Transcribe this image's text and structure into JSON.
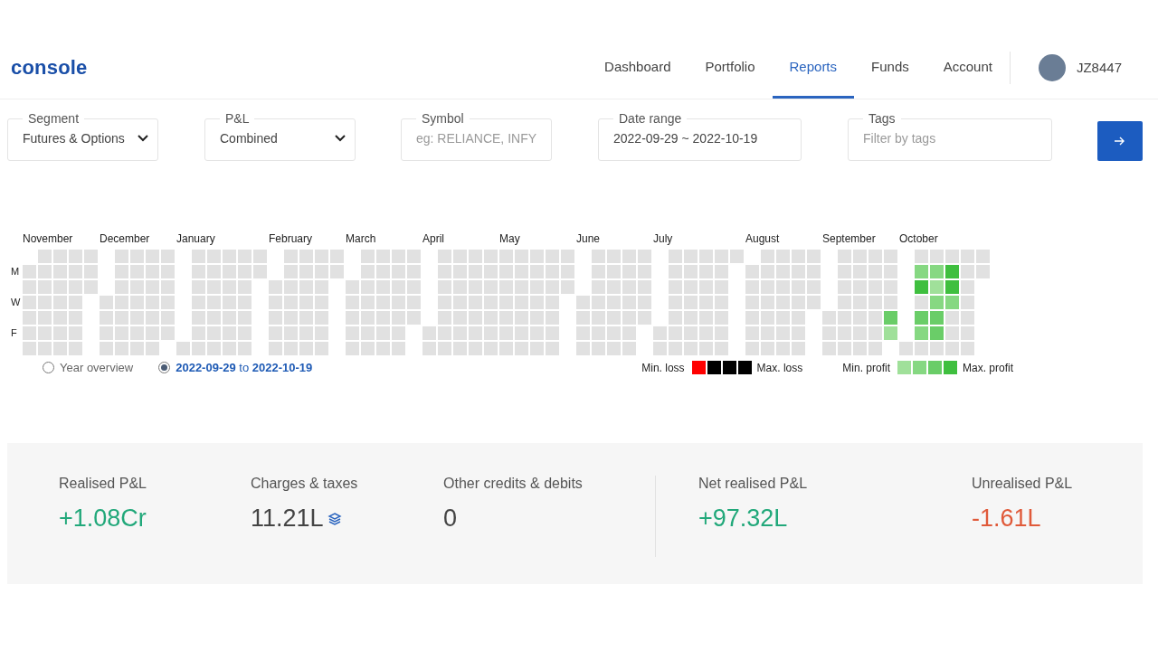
{
  "nav": {
    "logo": "console",
    "items": [
      {
        "label": "Dashboard",
        "selected": false
      },
      {
        "label": "Portfolio",
        "selected": false
      },
      {
        "label": "Reports",
        "selected": true
      },
      {
        "label": "Funds",
        "selected": false
      },
      {
        "label": "Account",
        "selected": false
      }
    ],
    "user": {
      "name": "JZ8447"
    }
  },
  "filters": [
    {
      "kind": "select",
      "label": "Segment",
      "value": "Futures & Options"
    },
    {
      "kind": "select",
      "label": "P&L",
      "value": "Combined"
    },
    {
      "kind": "input",
      "label": "Symbol",
      "placeholder": "eg: RELIANCE, INFY"
    },
    {
      "kind": "input",
      "label": "Date range",
      "value": "2022-09-29 ~ 2022-10-19"
    },
    {
      "kind": "input",
      "label": "Tags",
      "placeholder": "Filter by tags"
    }
  ],
  "heatmap": {
    "day_labels": [
      "M",
      "W",
      "F"
    ],
    "months": [
      {
        "label": "November",
        "weeks": [
          {
            "kind": "first",
            "days": [
              {
                "color": "#e1e1e1"
              },
              {
                "color": "#e1e1e1"
              },
              {
                "color": "#e1e1e1"
              },
              {
                "color": "#e1e1e1"
              },
              {
                "color": "#e1e1e1"
              },
              {
                "color": "#e1e1e1"
              }
            ]
          },
          {
            "kind": "full",
            "days": [
              {
                "color": "#e1e1e1"
              },
              {
                "color": "#e1e1e1"
              },
              {
                "color": "#e1e1e1"
              },
              {
                "color": "#e1e1e1"
              },
              {
                "color": "#e1e1e1"
              },
              {
                "color": "#e1e1e1"
              },
              {
                "color": "#e1e1e1"
              }
            ]
          },
          {
            "kind": "full",
            "days": [
              {
                "color": "#e1e1e1"
              },
              {
                "color": "#e1e1e1"
              },
              {
                "color": "#e1e1e1"
              },
              {
                "color": "#e1e1e1"
              },
              {
                "color": "#e1e1e1"
              },
              {
                "color": "#e1e1e1"
              },
              {
                "color": "#e1e1e1"
              }
            ]
          },
          {
            "kind": "full",
            "days": [
              {
                "color": "#e1e1e1"
              },
              {
                "color": "#e1e1e1"
              },
              {
                "color": "#e1e1e1"
              },
              {
                "color": "#e1e1e1"
              },
              {
                "color": "#e1e1e1"
              },
              {
                "color": "#e1e1e1"
              },
              {
                "color": "#e1e1e1"
              }
            ]
          },
          {
            "kind": "last",
            "days": [
              {
                "color": "#e1e1e1"
              },
              {
                "color": "#e1e1e1"
              },
              {
                "color": "#e1e1e1"
              }
            ]
          }
        ]
      },
      {
        "label": "December",
        "weeks": [
          {
            "kind": "first",
            "days": [
              {
                "color": "#e1e1e1"
              },
              {
                "color": "#e1e1e1"
              },
              {
                "color": "#e1e1e1"
              },
              {
                "color": "#e1e1e1"
              }
            ]
          },
          {
            "kind": "full",
            "days": [
              {
                "color": "#e1e1e1"
              },
              {
                "color": "#e1e1e1"
              },
              {
                "color": "#e1e1e1"
              },
              {
                "color": "#e1e1e1"
              },
              {
                "color": "#e1e1e1"
              },
              {
                "color": "#e1e1e1"
              },
              {
                "color": "#e1e1e1"
              }
            ]
          },
          {
            "kind": "full",
            "days": [
              {
                "color": "#e1e1e1"
              },
              {
                "color": "#e1e1e1"
              },
              {
                "color": "#e1e1e1"
              },
              {
                "color": "#e1e1e1"
              },
              {
                "color": "#e1e1e1"
              },
              {
                "color": "#e1e1e1"
              },
              {
                "color": "#e1e1e1"
              }
            ]
          },
          {
            "kind": "full",
            "days": [
              {
                "color": "#e1e1e1"
              },
              {
                "color": "#e1e1e1"
              },
              {
                "color": "#e1e1e1"
              },
              {
                "color": "#e1e1e1"
              },
              {
                "color": "#e1e1e1"
              },
              {
                "color": "#e1e1e1"
              },
              {
                "color": "#e1e1e1"
              }
            ]
          },
          {
            "kind": "last",
            "days": [
              {
                "color": "#e1e1e1"
              },
              {
                "color": "#e1e1e1"
              },
              {
                "color": "#e1e1e1"
              },
              {
                "color": "#e1e1e1"
              },
              {
                "color": "#e1e1e1"
              },
              {
                "color": "#e1e1e1"
              }
            ]
          }
        ]
      },
      {
        "label": "January",
        "weeks": [
          {
            "kind": "first",
            "days": [
              {
                "color": "#e1e1e1"
              }
            ]
          },
          {
            "kind": "full",
            "days": [
              {
                "color": "#e1e1e1"
              },
              {
                "color": "#e1e1e1"
              },
              {
                "color": "#e1e1e1"
              },
              {
                "color": "#e1e1e1"
              },
              {
                "color": "#e1e1e1"
              },
              {
                "color": "#e1e1e1"
              },
              {
                "color": "#e1e1e1"
              }
            ]
          },
          {
            "kind": "full",
            "days": [
              {
                "color": "#e1e1e1"
              },
              {
                "color": "#e1e1e1"
              },
              {
                "color": "#e1e1e1"
              },
              {
                "color": "#e1e1e1"
              },
              {
                "color": "#e1e1e1"
              },
              {
                "color": "#e1e1e1"
              },
              {
                "color": "#e1e1e1"
              }
            ]
          },
          {
            "kind": "full",
            "days": [
              {
                "color": "#e1e1e1"
              },
              {
                "color": "#e1e1e1"
              },
              {
                "color": "#e1e1e1"
              },
              {
                "color": "#e1e1e1"
              },
              {
                "color": "#e1e1e1"
              },
              {
                "color": "#e1e1e1"
              },
              {
                "color": "#e1e1e1"
              }
            ]
          },
          {
            "kind": "full",
            "days": [
              {
                "color": "#e1e1e1"
              },
              {
                "color": "#e1e1e1"
              },
              {
                "color": "#e1e1e1"
              },
              {
                "color": "#e1e1e1"
              },
              {
                "color": "#e1e1e1"
              },
              {
                "color": "#e1e1e1"
              },
              {
                "color": "#e1e1e1"
              }
            ]
          },
          {
            "kind": "last",
            "days": [
              {
                "color": "#e1e1e1"
              },
              {
                "color": "#e1e1e1"
              }
            ]
          }
        ]
      },
      {
        "label": "February",
        "weeks": [
          {
            "kind": "first",
            "days": [
              {
                "color": "#e1e1e1"
              },
              {
                "color": "#e1e1e1"
              },
              {
                "color": "#e1e1e1"
              },
              {
                "color": "#e1e1e1"
              },
              {
                "color": "#e1e1e1"
              }
            ]
          },
          {
            "kind": "full",
            "days": [
              {
                "color": "#e1e1e1"
              },
              {
                "color": "#e1e1e1"
              },
              {
                "color": "#e1e1e1"
              },
              {
                "color": "#e1e1e1"
              },
              {
                "color": "#e1e1e1"
              },
              {
                "color": "#e1e1e1"
              },
              {
                "color": "#e1e1e1"
              }
            ]
          },
          {
            "kind": "full",
            "days": [
              {
                "color": "#e1e1e1"
              },
              {
                "color": "#e1e1e1"
              },
              {
                "color": "#e1e1e1"
              },
              {
                "color": "#e1e1e1"
              },
              {
                "color": "#e1e1e1"
              },
              {
                "color": "#e1e1e1"
              },
              {
                "color": "#e1e1e1"
              }
            ]
          },
          {
            "kind": "full",
            "days": [
              {
                "color": "#e1e1e1"
              },
              {
                "color": "#e1e1e1"
              },
              {
                "color": "#e1e1e1"
              },
              {
                "color": "#e1e1e1"
              },
              {
                "color": "#e1e1e1"
              },
              {
                "color": "#e1e1e1"
              },
              {
                "color": "#e1e1e1"
              }
            ]
          },
          {
            "kind": "last",
            "days": [
              {
                "color": "#e1e1e1"
              },
              {
                "color": "#e1e1e1"
              }
            ]
          }
        ]
      },
      {
        "label": "March",
        "weeks": [
          {
            "kind": "first",
            "days": [
              {
                "color": "#e1e1e1"
              },
              {
                "color": "#e1e1e1"
              },
              {
                "color": "#e1e1e1"
              },
              {
                "color": "#e1e1e1"
              },
              {
                "color": "#e1e1e1"
              }
            ]
          },
          {
            "kind": "full",
            "days": [
              {
                "color": "#e1e1e1"
              },
              {
                "color": "#e1e1e1"
              },
              {
                "color": "#e1e1e1"
              },
              {
                "color": "#e1e1e1"
              },
              {
                "color": "#e1e1e1"
              },
              {
                "color": "#e1e1e1"
              },
              {
                "color": "#e1e1e1"
              }
            ]
          },
          {
            "kind": "full",
            "days": [
              {
                "color": "#e1e1e1"
              },
              {
                "color": "#e1e1e1"
              },
              {
                "color": "#e1e1e1"
              },
              {
                "color": "#e1e1e1"
              },
              {
                "color": "#e1e1e1"
              },
              {
                "color": "#e1e1e1"
              },
              {
                "color": "#e1e1e1"
              }
            ]
          },
          {
            "kind": "full",
            "days": [
              {
                "color": "#e1e1e1"
              },
              {
                "color": "#e1e1e1"
              },
              {
                "color": "#e1e1e1"
              },
              {
                "color": "#e1e1e1"
              },
              {
                "color": "#e1e1e1"
              },
              {
                "color": "#e1e1e1"
              },
              {
                "color": "#e1e1e1"
              }
            ]
          },
          {
            "kind": "last",
            "days": [
              {
                "color": "#e1e1e1"
              },
              {
                "color": "#e1e1e1"
              },
              {
                "color": "#e1e1e1"
              },
              {
                "color": "#e1e1e1"
              },
              {
                "color": "#e1e1e1"
              }
            ]
          }
        ]
      },
      {
        "label": "April",
        "weeks": [
          {
            "kind": "first",
            "days": [
              {
                "color": "#e1e1e1"
              },
              {
                "color": "#e1e1e1"
              }
            ]
          },
          {
            "kind": "full",
            "days": [
              {
                "color": "#e1e1e1"
              },
              {
                "color": "#e1e1e1"
              },
              {
                "color": "#e1e1e1"
              },
              {
                "color": "#e1e1e1"
              },
              {
                "color": "#e1e1e1"
              },
              {
                "color": "#e1e1e1"
              },
              {
                "color": "#e1e1e1"
              }
            ]
          },
          {
            "kind": "full",
            "days": [
              {
                "color": "#e1e1e1"
              },
              {
                "color": "#e1e1e1"
              },
              {
                "color": "#e1e1e1"
              },
              {
                "color": "#e1e1e1"
              },
              {
                "color": "#e1e1e1"
              },
              {
                "color": "#e1e1e1"
              },
              {
                "color": "#e1e1e1"
              }
            ]
          },
          {
            "kind": "full",
            "days": [
              {
                "color": "#e1e1e1"
              },
              {
                "color": "#e1e1e1"
              },
              {
                "color": "#e1e1e1"
              },
              {
                "color": "#e1e1e1"
              },
              {
                "color": "#e1e1e1"
              },
              {
                "color": "#e1e1e1"
              },
              {
                "color": "#e1e1e1"
              }
            ]
          },
          {
            "kind": "full",
            "days": [
              {
                "color": "#e1e1e1"
              },
              {
                "color": "#e1e1e1"
              },
              {
                "color": "#e1e1e1"
              },
              {
                "color": "#e1e1e1"
              },
              {
                "color": "#e1e1e1"
              },
              {
                "color": "#e1e1e1"
              },
              {
                "color": "#e1e1e1"
              }
            ]
          }
        ]
      },
      {
        "label": "May",
        "weeks": [
          {
            "kind": "full",
            "days": [
              {
                "color": "#e1e1e1"
              },
              {
                "color": "#e1e1e1"
              },
              {
                "color": "#e1e1e1"
              },
              {
                "color": "#e1e1e1"
              },
              {
                "color": "#e1e1e1"
              },
              {
                "color": "#e1e1e1"
              },
              {
                "color": "#e1e1e1"
              }
            ]
          },
          {
            "kind": "full",
            "days": [
              {
                "color": "#e1e1e1"
              },
              {
                "color": "#e1e1e1"
              },
              {
                "color": "#e1e1e1"
              },
              {
                "color": "#e1e1e1"
              },
              {
                "color": "#e1e1e1"
              },
              {
                "color": "#e1e1e1"
              },
              {
                "color": "#e1e1e1"
              }
            ]
          },
          {
            "kind": "full",
            "days": [
              {
                "color": "#e1e1e1"
              },
              {
                "color": "#e1e1e1"
              },
              {
                "color": "#e1e1e1"
              },
              {
                "color": "#e1e1e1"
              },
              {
                "color": "#e1e1e1"
              },
              {
                "color": "#e1e1e1"
              },
              {
                "color": "#e1e1e1"
              }
            ]
          },
          {
            "kind": "full",
            "days": [
              {
                "color": "#e1e1e1"
              },
              {
                "color": "#e1e1e1"
              },
              {
                "color": "#e1e1e1"
              },
              {
                "color": "#e1e1e1"
              },
              {
                "color": "#e1e1e1"
              },
              {
                "color": "#e1e1e1"
              },
              {
                "color": "#e1e1e1"
              }
            ]
          },
          {
            "kind": "last",
            "days": [
              {
                "color": "#e1e1e1"
              },
              {
                "color": "#e1e1e1"
              },
              {
                "color": "#e1e1e1"
              }
            ]
          }
        ]
      },
      {
        "label": "June",
        "weeks": [
          {
            "kind": "first",
            "days": [
              {
                "color": "#e1e1e1"
              },
              {
                "color": "#e1e1e1"
              },
              {
                "color": "#e1e1e1"
              },
              {
                "color": "#e1e1e1"
              }
            ]
          },
          {
            "kind": "full",
            "days": [
              {
                "color": "#e1e1e1"
              },
              {
                "color": "#e1e1e1"
              },
              {
                "color": "#e1e1e1"
              },
              {
                "color": "#e1e1e1"
              },
              {
                "color": "#e1e1e1"
              },
              {
                "color": "#e1e1e1"
              },
              {
                "color": "#e1e1e1"
              }
            ]
          },
          {
            "kind": "full",
            "days": [
              {
                "color": "#e1e1e1"
              },
              {
                "color": "#e1e1e1"
              },
              {
                "color": "#e1e1e1"
              },
              {
                "color": "#e1e1e1"
              },
              {
                "color": "#e1e1e1"
              },
              {
                "color": "#e1e1e1"
              },
              {
                "color": "#e1e1e1"
              }
            ]
          },
          {
            "kind": "full",
            "days": [
              {
                "color": "#e1e1e1"
              },
              {
                "color": "#e1e1e1"
              },
              {
                "color": "#e1e1e1"
              },
              {
                "color": "#e1e1e1"
              },
              {
                "color": "#e1e1e1"
              },
              {
                "color": "#e1e1e1"
              },
              {
                "color": "#e1e1e1"
              }
            ]
          },
          {
            "kind": "last",
            "days": [
              {
                "color": "#e1e1e1"
              },
              {
                "color": "#e1e1e1"
              },
              {
                "color": "#e1e1e1"
              },
              {
                "color": "#e1e1e1"
              },
              {
                "color": "#e1e1e1"
              }
            ]
          }
        ]
      },
      {
        "label": "July",
        "weeks": [
          {
            "kind": "first",
            "days": [
              {
                "color": "#e1e1e1"
              },
              {
                "color": "#e1e1e1"
              }
            ]
          },
          {
            "kind": "full",
            "days": [
              {
                "color": "#e1e1e1"
              },
              {
                "color": "#e1e1e1"
              },
              {
                "color": "#e1e1e1"
              },
              {
                "color": "#e1e1e1"
              },
              {
                "color": "#e1e1e1"
              },
              {
                "color": "#e1e1e1"
              },
              {
                "color": "#e1e1e1"
              }
            ]
          },
          {
            "kind": "full",
            "days": [
              {
                "color": "#e1e1e1"
              },
              {
                "color": "#e1e1e1"
              },
              {
                "color": "#e1e1e1"
              },
              {
                "color": "#e1e1e1"
              },
              {
                "color": "#e1e1e1"
              },
              {
                "color": "#e1e1e1"
              },
              {
                "color": "#e1e1e1"
              }
            ]
          },
          {
            "kind": "full",
            "days": [
              {
                "color": "#e1e1e1"
              },
              {
                "color": "#e1e1e1"
              },
              {
                "color": "#e1e1e1"
              },
              {
                "color": "#e1e1e1"
              },
              {
                "color": "#e1e1e1"
              },
              {
                "color": "#e1e1e1"
              },
              {
                "color": "#e1e1e1"
              }
            ]
          },
          {
            "kind": "full",
            "days": [
              {
                "color": "#e1e1e1"
              },
              {
                "color": "#e1e1e1"
              },
              {
                "color": "#e1e1e1"
              },
              {
                "color": "#e1e1e1"
              },
              {
                "color": "#e1e1e1"
              },
              {
                "color": "#e1e1e1"
              },
              {
                "color": "#e1e1e1"
              }
            ]
          },
          {
            "kind": "last",
            "days": [
              {
                "color": "#e1e1e1"
              }
            ]
          }
        ]
      },
      {
        "label": "August",
        "weeks": [
          {
            "kind": "first",
            "days": [
              {
                "color": "#e1e1e1"
              },
              {
                "color": "#e1e1e1"
              },
              {
                "color": "#e1e1e1"
              },
              {
                "color": "#e1e1e1"
              },
              {
                "color": "#e1e1e1"
              },
              {
                "color": "#e1e1e1"
              }
            ]
          },
          {
            "kind": "full",
            "days": [
              {
                "color": "#e1e1e1"
              },
              {
                "color": "#e1e1e1"
              },
              {
                "color": "#e1e1e1"
              },
              {
                "color": "#e1e1e1"
              },
              {
                "color": "#e1e1e1"
              },
              {
                "color": "#e1e1e1"
              },
              {
                "color": "#e1e1e1"
              }
            ]
          },
          {
            "kind": "full",
            "days": [
              {
                "color": "#e1e1e1"
              },
              {
                "color": "#e1e1e1"
              },
              {
                "color": "#e1e1e1"
              },
              {
                "color": "#e1e1e1"
              },
              {
                "color": "#e1e1e1"
              },
              {
                "color": "#e1e1e1"
              },
              {
                "color": "#e1e1e1"
              }
            ]
          },
          {
            "kind": "full",
            "days": [
              {
                "color": "#e1e1e1"
              },
              {
                "color": "#e1e1e1"
              },
              {
                "color": "#e1e1e1"
              },
              {
                "color": "#e1e1e1"
              },
              {
                "color": "#e1e1e1"
              },
              {
                "color": "#e1e1e1"
              },
              {
                "color": "#e1e1e1"
              }
            ]
          },
          {
            "kind": "last",
            "days": [
              {
                "color": "#e1e1e1"
              },
              {
                "color": "#e1e1e1"
              },
              {
                "color": "#e1e1e1"
              },
              {
                "color": "#e1e1e1"
              }
            ]
          }
        ]
      },
      {
        "label": "September",
        "weeks": [
          {
            "kind": "first",
            "days": [
              {
                "color": "#e1e1e1"
              },
              {
                "color": "#e1e1e1"
              },
              {
                "color": "#e1e1e1"
              }
            ]
          },
          {
            "kind": "full",
            "days": [
              {
                "color": "#e1e1e1"
              },
              {
                "color": "#e1e1e1"
              },
              {
                "color": "#e1e1e1"
              },
              {
                "color": "#e1e1e1"
              },
              {
                "color": "#e1e1e1"
              },
              {
                "color": "#e1e1e1"
              },
              {
                "color": "#e1e1e1"
              }
            ]
          },
          {
            "kind": "full",
            "days": [
              {
                "color": "#e1e1e1"
              },
              {
                "color": "#e1e1e1"
              },
              {
                "color": "#e1e1e1"
              },
              {
                "color": "#e1e1e1"
              },
              {
                "color": "#e1e1e1"
              },
              {
                "color": "#e1e1e1"
              },
              {
                "color": "#e1e1e1"
              }
            ]
          },
          {
            "kind": "full",
            "days": [
              {
                "color": "#e1e1e1"
              },
              {
                "color": "#e1e1e1"
              },
              {
                "color": "#e1e1e1"
              },
              {
                "color": "#e1e1e1"
              },
              {
                "color": "#e1e1e1"
              },
              {
                "color": "#e1e1e1"
              },
              {
                "color": "#e1e1e1"
              }
            ]
          },
          {
            "kind": "last",
            "days": [
              {
                "color": "#e1e1e1"
              },
              {
                "color": "#e1e1e1"
              },
              {
                "color": "#e1e1e1"
              },
              {
                "color": "#e1e1e1"
              },
              {
                "color": "#6acd68"
              },
              {
                "color": "#a0e09a"
              }
            ]
          }
        ]
      },
      {
        "label": "October",
        "weeks": [
          {
            "kind": "first",
            "days": [
              {
                "color": "#e1e1e1"
              }
            ]
          },
          {
            "kind": "full",
            "days": [
              {
                "color": "#e1e1e1"
              },
              {
                "color": "#86d882"
              },
              {
                "color": "#3fbf3f"
              },
              {
                "color": "#e1e1e1"
              },
              {
                "color": "#6acd68"
              },
              {
                "color": "#86d882"
              },
              {
                "color": "#e1e1e1"
              }
            ]
          },
          {
            "kind": "full",
            "days": [
              {
                "color": "#e1e1e1"
              },
              {
                "color": "#86d882"
              },
              {
                "color": "#a0e09a"
              },
              {
                "color": "#86d882"
              },
              {
                "color": "#6acd68"
              },
              {
                "color": "#6acd68"
              },
              {
                "color": "#e1e1e1"
              }
            ]
          },
          {
            "kind": "full",
            "days": [
              {
                "color": "#e1e1e1"
              },
              {
                "color": "#3fbf3f"
              },
              {
                "color": "#3fbf3f"
              },
              {
                "color": "#86d882"
              },
              {
                "color": "#e1e1e1"
              },
              {
                "color": "#e1e1e1"
              },
              {
                "color": "#e1e1e1"
              }
            ]
          },
          {
            "kind": "full",
            "days": [
              {
                "color": "#e1e1e1"
              },
              {
                "color": "#e1e1e1"
              },
              {
                "color": "#e1e1e1"
              },
              {
                "color": "#e1e1e1"
              },
              {
                "color": "#e1e1e1"
              },
              {
                "color": "#e1e1e1"
              },
              {
                "color": "#e1e1e1"
              }
            ]
          },
          {
            "kind": "last",
            "days": [
              {
                "color": "#e1e1e1"
              },
              {
                "color": "#e1e1e1"
              }
            ]
          }
        ]
      }
    ]
  },
  "views": [
    {
      "label": "Year overview",
      "selected": false
    },
    {
      "label": "**2022-09-29** to **2022-10-19**",
      "selected": true
    }
  ],
  "legend": {
    "loss": {
      "min_label": "Min. loss",
      "max_label": "Max. loss",
      "swatches": [
        {
          "color": "#ff0000"
        },
        {
          "color": "#000000"
        },
        {
          "color": "#000000"
        },
        {
          "color": "#000000"
        }
      ]
    },
    "profit": {
      "min_label": "Min. profit",
      "max_label": "Max. profit",
      "swatches": [
        {
          "color": "#a0e09a"
        },
        {
          "color": "#86d882"
        },
        {
          "color": "#6acd68"
        },
        {
          "color": "#3fbf3f"
        }
      ]
    }
  },
  "stats": [
    {
      "kind": "plain",
      "label": "Realised P&L",
      "value": "+1.08Cr",
      "color": "#21a87a",
      "divider_before": false
    },
    {
      "kind": "breakdown",
      "label": "Charges & taxes",
      "value": "11.21L",
      "color": "#444444",
      "divider_before": false
    },
    {
      "kind": "plain",
      "label": "Other credits & debits",
      "value": "0",
      "color": "#444444",
      "divider_before": false
    },
    {
      "kind": "plain",
      "label": "Net realised P&L",
      "value": "+97.32L",
      "color": "#21a87a",
      "divider_before": true
    },
    {
      "kind": "plain",
      "label": "Unrealised P&L",
      "value": "-1.61L",
      "color": "#e05a3a",
      "divider_before": false
    }
  ]
}
